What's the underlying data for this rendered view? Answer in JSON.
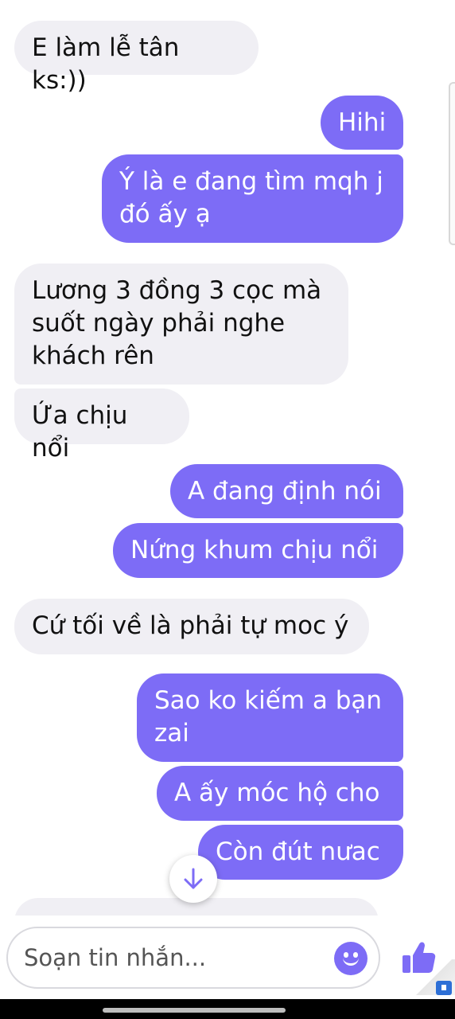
{
  "conversation": {
    "messages": [
      {
        "from": "other",
        "text": "E làm lễ tân ks:))"
      },
      {
        "from": "me",
        "text": "Hihi"
      },
      {
        "from": "me",
        "text": "Ý là e đang tìm mqh j\nđó ấy ạ"
      },
      {
        "from": "other",
        "text": "Lương 3 đồng 3 cọc mà\nsuốt ngày phải nghe\nkhách rên"
      },
      {
        "from": "other",
        "text": "Ứa chịu nổi"
      },
      {
        "from": "me",
        "text": "A đang định nói"
      },
      {
        "from": "me",
        "text": "Nứng khum chịu nổi"
      },
      {
        "from": "other",
        "text": "Cứ tối về là phải tự moc ý"
      },
      {
        "from": "me",
        "text": "Sao ko kiếm a bạn\nzai"
      },
      {
        "from": "me",
        "text": "A ấy móc hộ cho"
      },
      {
        "from": "me",
        "text": "Còn đút nưac"
      }
    ]
  },
  "composer": {
    "placeholder": "Soạn tin nhắn...",
    "emoji_icon": "emoji-smile-icon",
    "like_icon": "thumbs-up-icon"
  },
  "jump_button_icon": "arrow-down-icon",
  "colors": {
    "sent_bubble": "#7d6cf6",
    "received_bubble": "#f0eff4",
    "accent": "#7d6cf6"
  }
}
